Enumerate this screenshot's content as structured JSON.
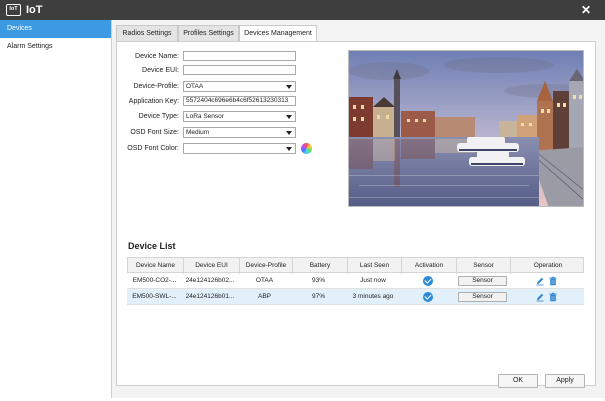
{
  "window": {
    "title": "IoT",
    "icon_text": "IoT"
  },
  "sidebar": {
    "items": [
      {
        "label": "Devices"
      },
      {
        "label": "Alarm Settings"
      }
    ]
  },
  "tabs": [
    {
      "label": "Radios Settings"
    },
    {
      "label": "Profiles Settings"
    },
    {
      "label": "Devices Management"
    }
  ],
  "form": {
    "device_name": {
      "label": "Device Name:",
      "value": ""
    },
    "device_eui": {
      "label": "Device EUI:",
      "value": ""
    },
    "device_profile": {
      "label": "Device-Profile:",
      "value": "OTAA"
    },
    "application_key": {
      "label": "Application Key:",
      "value": "5572404c696e6b4c6f52613230313"
    },
    "device_type": {
      "label": "Device Type:",
      "value": "LoRa Sensor"
    },
    "osd_font_size": {
      "label": "OSD Font Size:",
      "value": "Medium"
    },
    "osd_font_color": {
      "label": "OSD Font Color:",
      "value": ""
    }
  },
  "device_list": {
    "title": "Device List",
    "columns": [
      "Device Name",
      "Device EUI",
      "Device-Profile",
      "Battery",
      "Last Seen",
      "Activation",
      "Sensor",
      "Operation"
    ],
    "rows": [
      {
        "name": "EM500-CO2-...",
        "eui": "24e124126b02...",
        "profile": "OTAA",
        "battery": "93%",
        "last_seen": "Just now",
        "sensor_label": "Sensor"
      },
      {
        "name": "EM500-SWL-...",
        "eui": "24e124126b01...",
        "profile": "ABP",
        "battery": "97%",
        "last_seen": "3 minutes ago",
        "sensor_label": "Sensor"
      }
    ]
  },
  "footer": {
    "ok_label": "OK",
    "apply_label": "Apply"
  },
  "colors": {
    "titlebar": "#3e3e3e",
    "accent": "#3b9ae1",
    "selected_row": "#e2f0fb",
    "check": "#2a8ad8"
  }
}
